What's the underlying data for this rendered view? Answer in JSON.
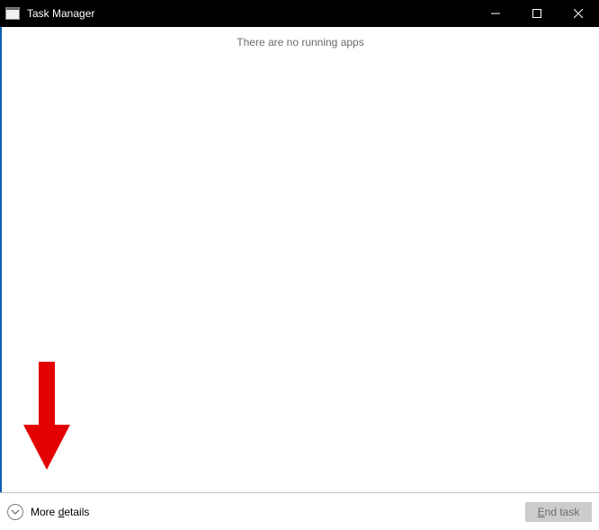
{
  "window": {
    "title": "Task Manager"
  },
  "content": {
    "empty_message": "There are no running apps"
  },
  "footer": {
    "more_pre": "More ",
    "more_accel": "d",
    "more_post": "etails",
    "end_accel": "E",
    "end_post": "nd task"
  }
}
